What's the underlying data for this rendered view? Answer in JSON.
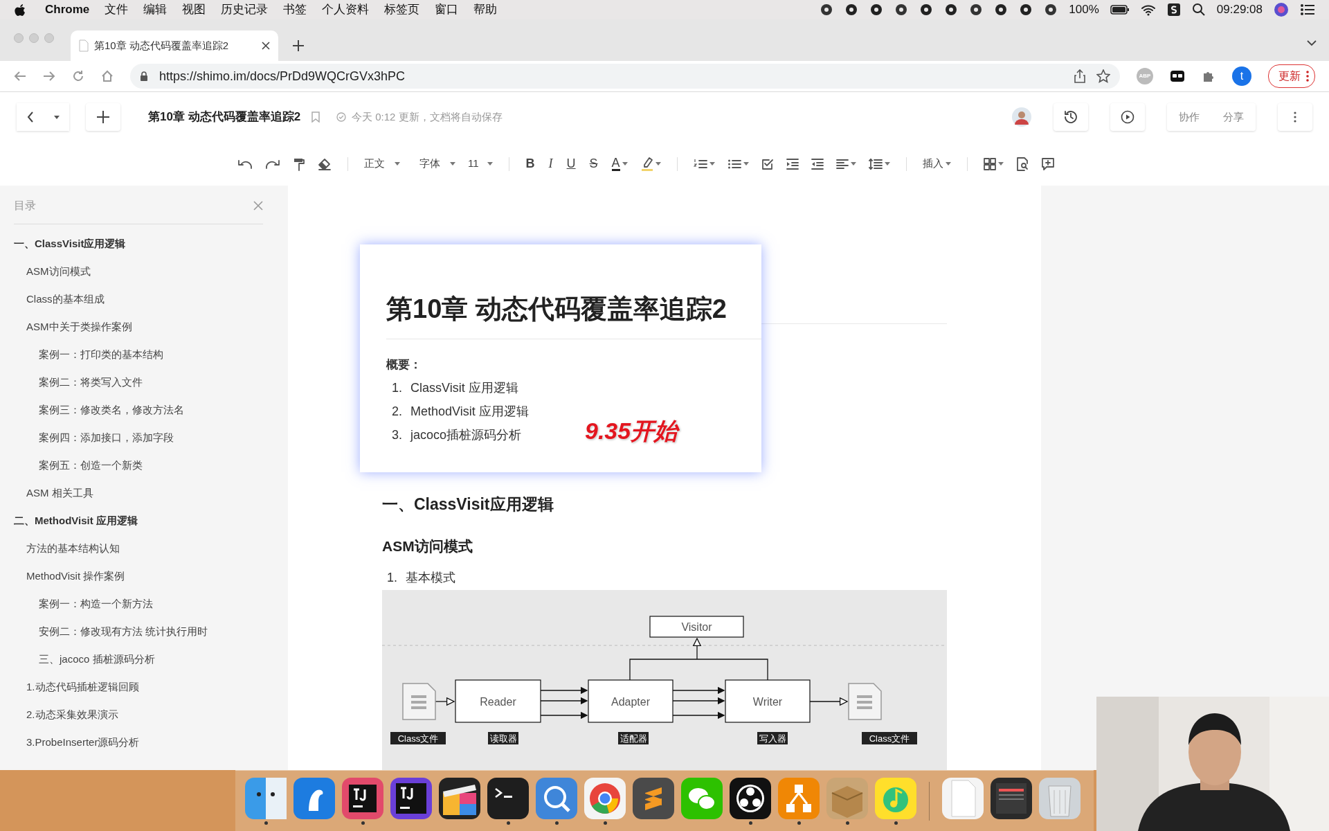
{
  "menubar": {
    "app": "Chrome",
    "menus": [
      "文件",
      "编辑",
      "视图",
      "历史记录",
      "书签",
      "个人资料",
      "标签页",
      "窗口",
      "帮助"
    ],
    "battery": "100%",
    "clock": "09:29:08"
  },
  "browser": {
    "tab_title": "第10章 动态代码覆盖率追踪2",
    "url": "https://shimo.im/docs/PrDd9WQCrGVx3hPC",
    "extension_label": "ABP",
    "profile": "t",
    "update": "更新"
  },
  "doc_header": {
    "title": "第10章 动态代码覆盖率追踪2",
    "save_status": "今天 0:12 更新，文档将自动保存",
    "buttons": [
      "协作",
      "分享"
    ]
  },
  "toolbar": {
    "style": "正文",
    "font": "字体",
    "size": "11",
    "format": [
      "B",
      "I",
      "U",
      "S",
      "A"
    ],
    "insert": "插入"
  },
  "toc": {
    "title": "目录",
    "items": [
      {
        "text": "一、ClassVisit应用逻辑",
        "children": [
          {
            "text": "ASM访问模式"
          },
          {
            "text": "Class的基本组成"
          },
          {
            "text": "ASM中关于类操作案例",
            "children": [
              {
                "text": "案例一：打印类的基本结构"
              },
              {
                "text": "案例二：将类写入文件"
              },
              {
                "text": "案例三：修改类名，修改方法名"
              },
              {
                "text": "案例四：添加接口，添加字段"
              },
              {
                "text": "案例五：创造一个新类"
              }
            ]
          },
          {
            "text": "ASM 相关工具"
          }
        ]
      },
      {
        "text": "二、MethodVisit 应用逻辑",
        "children": [
          {
            "text": "方法的基本结构认知"
          },
          {
            "text": "MethodVisit 操作案例",
            "children": [
              {
                "text": "案例一：构造一个新方法"
              },
              {
                "text": "安例二：修改现有方法 统计执行用时"
              },
              {
                "text": "三、jacoco 插桩源码分析"
              }
            ]
          },
          {
            "text": "1.动态代码插桩逻辑回顾"
          },
          {
            "text": "2.动态采集效果演示"
          },
          {
            "text": "3.ProbeInserter源码分析"
          }
        ]
      }
    ]
  },
  "document": {
    "card": {
      "title": "第10章 动态代码覆盖率追踪2",
      "summary_label": "概要：",
      "summary": [
        {
          "number": "1.",
          "text": "ClassVisit 应用逻辑"
        },
        {
          "number": "2.",
          "text": "MethodVisit 应用逻辑"
        },
        {
          "number": "3.",
          "text": "jacoco插桩源码分析"
        }
      ]
    },
    "note": "9.35开始",
    "heading1": "一、ClassVisit应用逻辑",
    "heading2": "ASM访问模式",
    "list": [
      {
        "number": "1.",
        "text": "基本模式"
      }
    ],
    "diagram": {
      "visitor": "Visitor",
      "stages": [
        "Reader",
        "Adapter",
        "Writer"
      ],
      "labels": [
        "Class文件",
        "读取器",
        "适配器",
        "写入器",
        "Class文件"
      ]
    }
  },
  "dock": {
    "apps": [
      {
        "kind": "finder",
        "running": true
      },
      {
        "kind": "bird",
        "running": false
      },
      {
        "kind": "ide",
        "running": true
      },
      {
        "kind": "ide-dark",
        "running": false
      },
      {
        "kind": "clapper",
        "running": false
      },
      {
        "kind": "terminal",
        "running": true
      },
      {
        "kind": "dictionary",
        "running": true
      },
      {
        "kind": "browser",
        "running": true
      },
      {
        "kind": "editor",
        "running": false
      },
      {
        "kind": "chat",
        "running": false
      },
      {
        "kind": "recorder",
        "running": true
      },
      {
        "kind": "diagram",
        "running": true
      },
      {
        "kind": "box",
        "running": true
      },
      {
        "kind": "music",
        "running": true
      },
      {
        "kind": "divider"
      },
      {
        "kind": "document",
        "running": false
      },
      {
        "kind": "window",
        "running": false
      },
      {
        "kind": "trash",
        "running": false
      }
    ]
  }
}
